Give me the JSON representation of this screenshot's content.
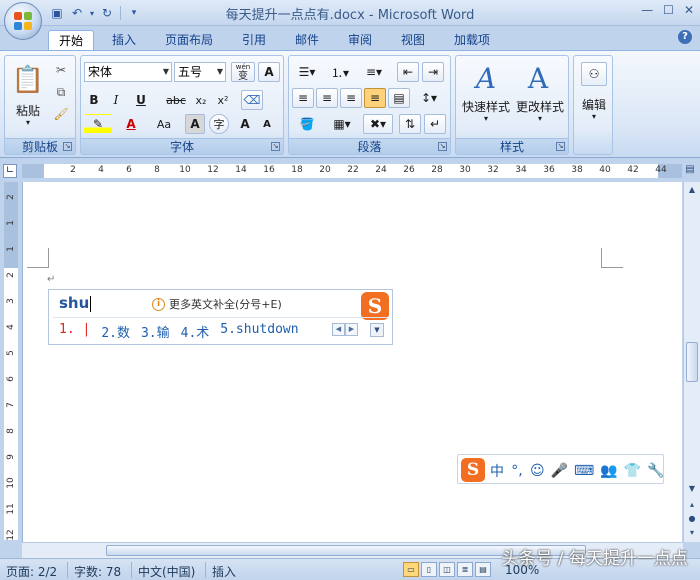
{
  "window": {
    "title": "每天提升一点点有.docx - Microsoft Word",
    "controls": [
      "—",
      "☐",
      "✕"
    ]
  },
  "tabs": [
    {
      "label": "开始",
      "active": true
    },
    {
      "label": "插入"
    },
    {
      "label": "页面布局"
    },
    {
      "label": "引用"
    },
    {
      "label": "邮件"
    },
    {
      "label": "审阅"
    },
    {
      "label": "视图"
    },
    {
      "label": "加载项"
    }
  ],
  "ribbon": {
    "clipboard": {
      "label": "剪贴板",
      "paste": "粘贴"
    },
    "font": {
      "label": "字体",
      "font_name": "宋体",
      "font_size": "五号",
      "phonetic": "wén",
      "phonetic_char": "变",
      "char_border": "A",
      "bold": "B",
      "italic": "I",
      "underline": "U",
      "strike": "abc",
      "sub": "x₂",
      "sup": "x²",
      "change_case": "Aa",
      "grow": "A",
      "shrink": "A",
      "char_shading": "A",
      "enclose": "字"
    },
    "paragraph": {
      "label": "段落"
    },
    "styles": {
      "label": "样式",
      "quick": "快速样式",
      "change": "更改样式"
    },
    "editing": {
      "label": "编辑"
    }
  },
  "ruler": {
    "h_ticks": [
      "2",
      "4",
      "6",
      "8",
      "10",
      "12",
      "14",
      "16",
      "18",
      "20",
      "22",
      "24",
      "26",
      "28",
      "30",
      "32",
      "34",
      "36",
      "38",
      "40",
      "42",
      "44"
    ],
    "v_ticks": [
      "2",
      "1",
      "1",
      "2",
      "3",
      "4",
      "5",
      "6",
      "7",
      "8",
      "9",
      "10",
      "11",
      "12"
    ]
  },
  "ime": {
    "input": "shu",
    "hint": "更多英文补全(分号+E)",
    "hint_icon": "i",
    "logo": "S",
    "candidates": [
      "1. |",
      "2.数",
      "3.输",
      "4.术",
      "5.shutdown"
    ]
  },
  "ime_toolbar": {
    "logo": "S",
    "items": [
      "中",
      "°,",
      "☺",
      "🎤",
      "⌨",
      "👥",
      "👕",
      "🔧"
    ]
  },
  "status": {
    "page": "页面: 2/2",
    "words": "字数: 78",
    "language": "中文(中国)",
    "mode": "插入",
    "zoom": "100%"
  },
  "watermark": "头条号 / 每天提升一点点"
}
